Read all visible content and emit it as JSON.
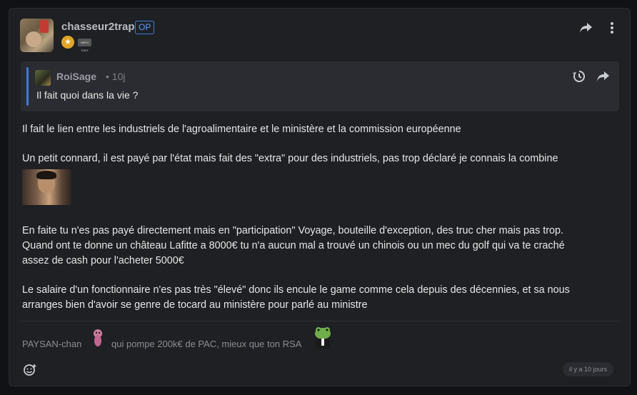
{
  "post": {
    "author": "chasseur2trap",
    "op_label": "OP",
    "badge_text": "HÉRO TOUT",
    "quote": {
      "author": "RoiSage",
      "time": "10j",
      "separator": "•",
      "text": "Il fait quoi dans la vie ?"
    },
    "paragraphs": [
      "Il fait le lien entre les industriels de l'agroalimentaire et le ministère et la commission européenne",
      "Un petit connard, il est payé par l'état mais fait des \"extra\" pour des industriels, pas trop déclaré je connais la combine",
      "En faite tu n'es pas payé directement mais en \"participation\" Voyage, bouteille d'exception, des truc cher mais pas trop.",
      "Quand ont te donne un château Lafitte a 8000€ tu n'a aucun mal a trouvé un chinois ou un mec du golf qui va te craché",
      "assez de cash pour l'acheter 5000€",
      "Le salaire d'un fonctionnaire n'es pas très \"élevé\" donc ils encule le game comme cela depuis des décennies, et sa nous",
      "arranges bien d'avoir se genre de tocard au ministère pour parlé au ministre"
    ],
    "signature": {
      "name": "PAYSAN-chan",
      "text": "qui pompe 200k€ de PAC, mieux que ton RSA"
    },
    "timestamp": "il y a 10 jours"
  },
  "icons": {
    "share": "share-icon",
    "more": "more-vertical-icon",
    "history": "history-icon",
    "reaction": "add-reaction-icon"
  },
  "colors": {
    "background": "#111215",
    "card": "#1f2024",
    "quote_bg": "#2b2c31",
    "accent": "#3b7ddd",
    "badge_gold": "#e0a526"
  }
}
